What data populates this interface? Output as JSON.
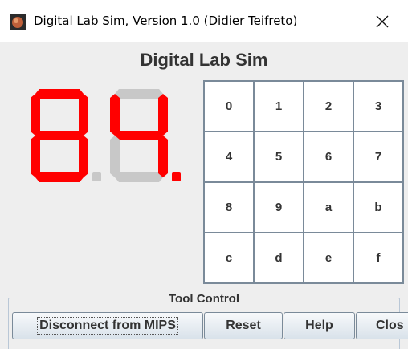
{
  "window": {
    "title": "Digital Lab Sim,  Version 1.0 (Didier Teifreto)",
    "icon": "app-logo-icon",
    "close_icon": "close-icon"
  },
  "app": {
    "title": "Digital Lab Sim"
  },
  "display": {
    "digits": [
      {
        "value": "8",
        "decimal_point_on": false
      },
      {
        "value": "4",
        "decimal_point_on": true
      }
    ],
    "colors": {
      "segment_on": "#ff0000",
      "segment_off": "#c8c8c8"
    }
  },
  "keypad": {
    "keys": [
      "0",
      "1",
      "2",
      "3",
      "4",
      "5",
      "6",
      "7",
      "8",
      "9",
      "a",
      "b",
      "c",
      "d",
      "e",
      "f"
    ]
  },
  "tool_control": {
    "title": "Tool Control",
    "buttons": {
      "disconnect": "Disconnect from MIPS",
      "reset": "Reset",
      "help": "Help",
      "close": "Clos"
    }
  }
}
